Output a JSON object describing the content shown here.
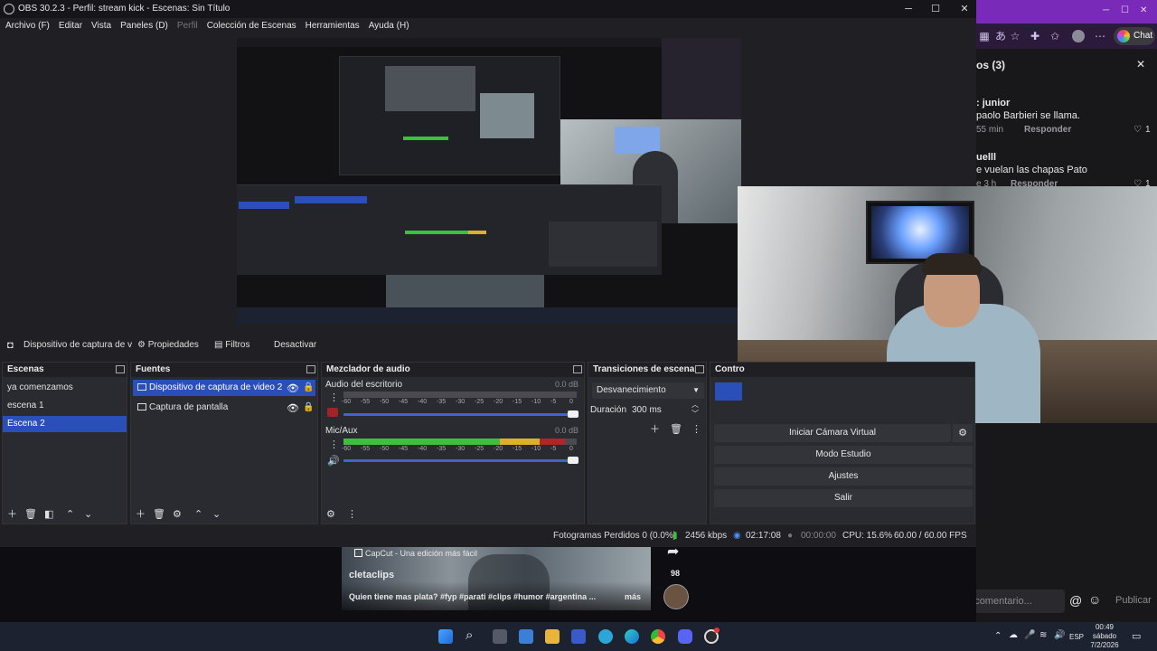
{
  "window": {
    "title": "OBS 30.2.3 - Perfil: stream kick - Escenas: Sin Título",
    "minimize": "─",
    "maximize": "☐",
    "close": "✕"
  },
  "menu": [
    {
      "label": "Archivo (F)",
      "disabled": false
    },
    {
      "label": "Editar",
      "disabled": false
    },
    {
      "label": "Vista",
      "disabled": false
    },
    {
      "label": "Paneles (D)",
      "disabled": false
    },
    {
      "label": "Perfil",
      "disabled": true
    },
    {
      "label": "Colección de Escenas",
      "disabled": false
    },
    {
      "label": "Herramientas",
      "disabled": false
    },
    {
      "label": "Ayuda (H)",
      "disabled": false
    }
  ],
  "source_toolbar": {
    "selected_source": "Dispositivo de captura de v",
    "properties": "Propiedades",
    "filters": "Filtros",
    "deactivate": "Desactivar"
  },
  "scenes": {
    "title": "Escenas",
    "items": [
      {
        "label": "ya comenzamos",
        "selected": false
      },
      {
        "label": "escena 1",
        "selected": false
      },
      {
        "label": "Escena 2",
        "selected": true
      }
    ]
  },
  "sources": {
    "title": "Fuentes",
    "items": [
      {
        "label": "Dispositivo de captura de video 2",
        "icon": "camera-icon",
        "selected": true
      },
      {
        "label": "Captura de pantalla",
        "icon": "monitor-icon",
        "selected": false
      }
    ]
  },
  "mixer": {
    "title": "Mezclador de audio",
    "ticks": [
      "-60",
      "-55",
      "-50",
      "-45",
      "-40",
      "-35",
      "-30",
      "-25",
      "-20",
      "-15",
      "-10",
      "-5",
      "0"
    ],
    "channels": [
      {
        "name": "Audio del escritorio",
        "db": "0.0 dB",
        "muted": true,
        "level": 0.0,
        "volume": 1.0
      },
      {
        "name": "Mic/Aux",
        "db": "0.0 dB",
        "muted": false,
        "level": 0.95,
        "volume": 1.0
      }
    ]
  },
  "transitions": {
    "title": "Transiciones de escena",
    "selected": "Desvanecimiento",
    "duration_label": "Duración",
    "duration_value": "300 ms"
  },
  "controls": {
    "title": "Contro",
    "virtual_cam": "Iniciar Cámara Virtual",
    "studio_mode": "Modo Estudio",
    "settings": "Ajustes",
    "exit": "Salir"
  },
  "status": {
    "dropped": "Fotogramas Perdidos 0 (0.0%)",
    "bitrate": "2456 kbps",
    "live_time": "02:17:08",
    "rec_time": "00:00:00",
    "cpu": "CPU: 15.6%",
    "fps": "60.00 / 60.00 FPS"
  },
  "comments": {
    "header": "os (3)",
    "items": [
      {
        "user": ": junior",
        "text": "paolo Barbieri se llama.",
        "time": "55 min",
        "reply": "Responder",
        "likes": "1"
      },
      {
        "user": "uelll",
        "text": "e vuelan las chapas Pato",
        "time": "e 3 h",
        "reply": "Responder",
        "likes": "1"
      }
    ],
    "add_placeholder": "Agregar comentario...",
    "publish": "Publicar"
  },
  "video": {
    "source_badge": "CapCut - Una edición más fácil",
    "author": "cletaclips",
    "caption": "Quien tiene mas plata? #fyp #parati #clips #humor #argentina ...",
    "more": "más",
    "shares": "98"
  },
  "taskbar": {
    "time": "00:49",
    "day": "sábado",
    "date": "7/2/2026",
    "lang": "ESP"
  },
  "colors": {
    "accent": "#2b4fb8",
    "twitch": "#7a2ab8",
    "meter_green": "#3ec03e",
    "meter_yellow": "#d9b12a",
    "meter_red": "#b0242c"
  }
}
